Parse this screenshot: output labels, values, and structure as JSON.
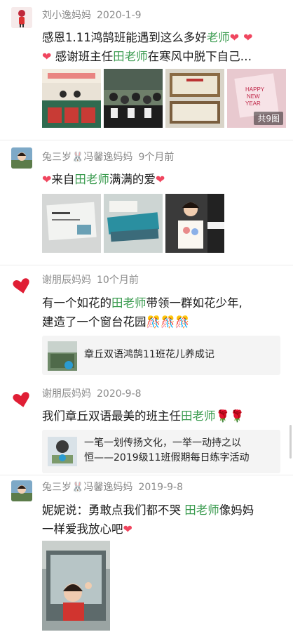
{
  "posts": [
    {
      "author": "刘小逸妈妈",
      "time": "2020-1-9",
      "line1a": "感恩1.11鸿鹄班能遇到这么多好",
      "line1b": "老师",
      "line2a": "感谢班主任",
      "line2b": "田老师",
      "line2c": "在寒风中脱下自己…",
      "photo_count": "共9图"
    },
    {
      "author": "兔三岁🐰冯馨逸妈妈",
      "time": "9个月前",
      "text_a": "来自",
      "text_b": "田老师",
      "text_c": "满满的爱"
    },
    {
      "author": "谢朋辰妈妈",
      "time": "10个月前",
      "line1a": "有一个如花的",
      "line1b": "田老师",
      "line1c": "带领一群如花少年,",
      "line2": "建造了一个窗台花园🎊🎊🎊",
      "link_title": "章丘双语鸿鹄11班花儿养成记"
    },
    {
      "author": "谢朋辰妈妈",
      "time": "2020-9-8",
      "text_a": "我们章丘双语最美的班主任",
      "text_b": "田老师",
      "text_c": "🌹🌹",
      "link_line1": "一笔一划传扬文化，一举一动持之以",
      "link_line2": "恒——2019级11班假期每日练字活动"
    },
    {
      "author": "兔三岁🐰冯馨逸妈妈",
      "time": "2019-9-8",
      "line1a": "妮妮说：勇敢点我们都不哭 ",
      "line1b": "田老师",
      "line1c": "像妈妈",
      "line2": "一样爱我放心吧"
    }
  ],
  "icons": {
    "heart": "heart-emoji",
    "heart_color": "#f0465f",
    "highlight_color": "#3a9b4f"
  }
}
